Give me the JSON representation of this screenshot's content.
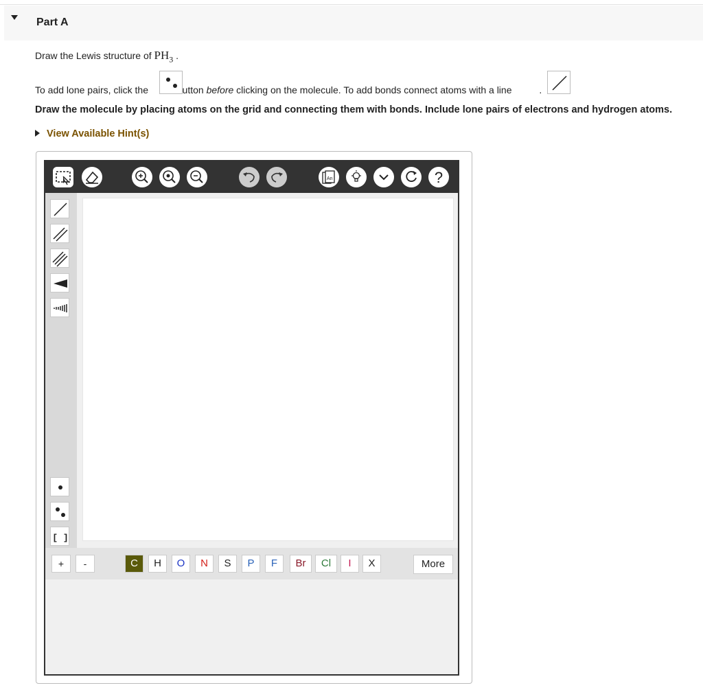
{
  "part": {
    "title": "Part A"
  },
  "question": {
    "prompt_prefix": "Draw the Lewis structure of ",
    "formula_main": "PH",
    "formula_sub": "3",
    "prompt_suffix": " .",
    "lone_pair_prefix": "To add lone pairs, click the ",
    "lone_pair_middle": " button ",
    "lone_pair_emph": "before",
    "lone_pair_rest": " clicking on the molecule. To add bonds connect atoms with a line ",
    "lone_pair_end": ".",
    "instruction": "Draw the molecule by placing atoms on the grid and connecting them with bonds. Include lone pairs of electrons and hydrogen atoms."
  },
  "hint": {
    "label": "View Available Hint(s)"
  },
  "toolbar": {
    "icons": [
      "marquee-select-icon",
      "eraser-icon",
      "zoom-in-icon",
      "zoom-fit-icon",
      "zoom-out-icon",
      "undo-icon",
      "redo-icon",
      "templates-icon",
      "lightbulb-icon",
      "chevron-down-icon",
      "reset-icon",
      "help-icon"
    ],
    "templates_glyph": "An",
    "help_glyph": "?"
  },
  "sidebar": {
    "tools": [
      "single-bond",
      "double-bond",
      "triple-bond",
      "wedge-bond",
      "hash-bond",
      "single-electron",
      "lone-pair",
      "bracket"
    ],
    "bracket_glyph": "[ ]"
  },
  "bottom": {
    "plus": "+",
    "minus": "-",
    "atoms": [
      {
        "symbol": "C",
        "color": "#ffffff",
        "bg": "#5a5a0a"
      },
      {
        "symbol": "H",
        "color": "#222222",
        "bg": "#ffffff"
      },
      {
        "symbol": "O",
        "color": "#1c34c4",
        "bg": "#ffffff"
      },
      {
        "symbol": "N",
        "color": "#d4201a",
        "bg": "#ffffff"
      },
      {
        "symbol": "S",
        "color": "#222222",
        "bg": "#ffffff"
      },
      {
        "symbol": "P",
        "color": "#2a62b8",
        "bg": "#ffffff"
      },
      {
        "symbol": "F",
        "color": "#2a62b8",
        "bg": "#ffffff"
      },
      {
        "symbol": "Br",
        "color": "#8a1a2a",
        "bg": "#ffffff"
      },
      {
        "symbol": "Cl",
        "color": "#2e7a3a",
        "bg": "#ffffff"
      },
      {
        "symbol": "I",
        "color": "#c31a52",
        "bg": "#ffffff"
      },
      {
        "symbol": "X",
        "color": "#222222",
        "bg": "#ffffff"
      }
    ],
    "more": "More"
  }
}
